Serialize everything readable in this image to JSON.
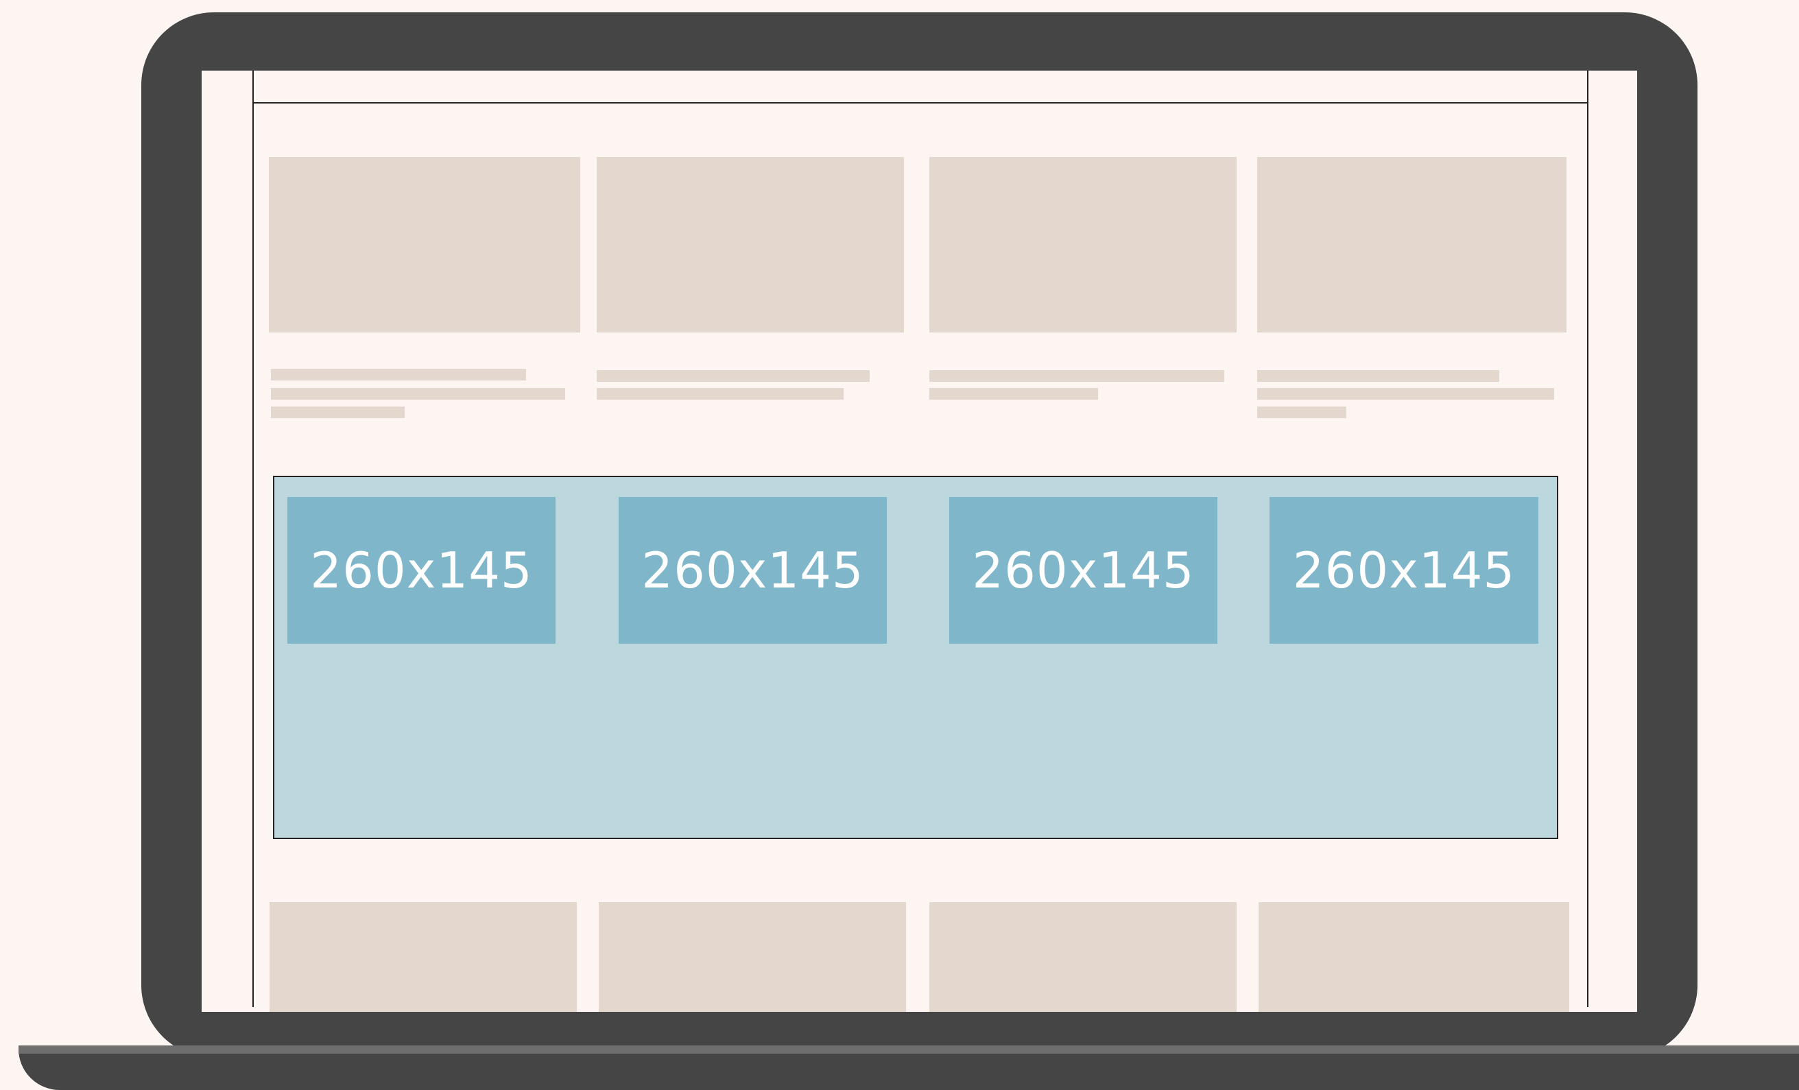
{
  "featured": {
    "placeholders": [
      {
        "label": "260x145"
      },
      {
        "label": "260x145"
      },
      {
        "label": "260x145"
      },
      {
        "label": "260x145"
      }
    ]
  },
  "colors": {
    "background": "#fdf5f1",
    "device_body": "#454545",
    "placeholder_block": "#e3d7ce",
    "featured_band": "#bdd7de",
    "ad_slot": "#7fb6ca",
    "ad_text": "#ffffff"
  }
}
